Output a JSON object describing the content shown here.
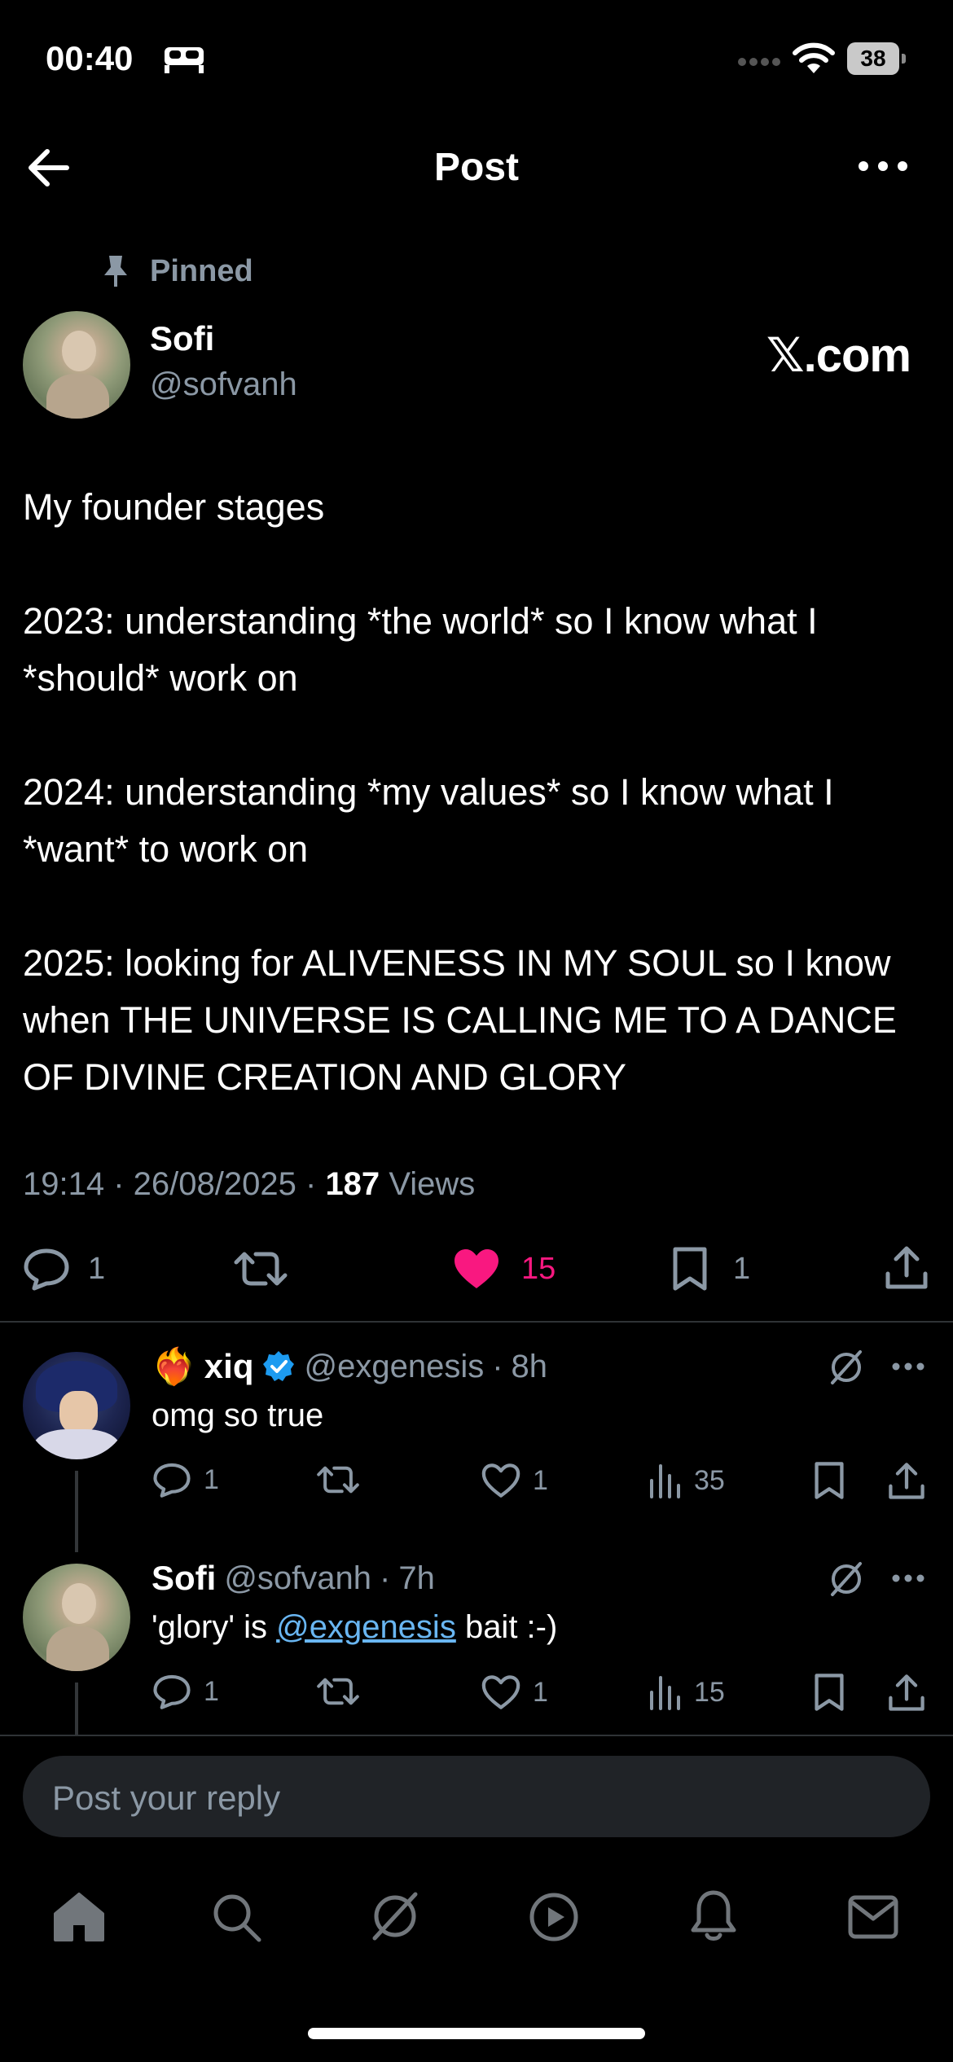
{
  "status_bar": {
    "time": "00:40",
    "battery": "38",
    "icons": [
      "bed-icon",
      "signal-dots",
      "wifi-icon",
      "battery"
    ]
  },
  "header": {
    "title": "Post",
    "back_icon": "arrow-left-icon",
    "more_icon": "more-horizontal-icon"
  },
  "post": {
    "pinned_label": "Pinned",
    "author_name": "Sofi",
    "author_handle": "@sofvanh",
    "brand": "𝕏.com",
    "text": "My founder stages\n\n2023: understanding *the world* so I know what I *should* work on\n\n2024: understanding *my values* so I know what I *want* to work on\n\n2025: looking for ALIVENESS IN MY SOUL so I know when THE UNIVERSE IS CALLING ME TO A DANCE OF DIVINE CREATION AND GLORY",
    "time": "19:14",
    "date": "26/08/2025",
    "views_count": "187",
    "views_label": "Views",
    "actions": {
      "replies": "1",
      "likes": "15",
      "bookmarks": "1"
    },
    "colors": {
      "like": "#f91880",
      "secondary_text": "#8b98a5"
    }
  },
  "replies": [
    {
      "emoji": "❤️‍🔥",
      "name": "xiq",
      "verified": true,
      "handle": "@exgenesis",
      "time": "8h",
      "text": "omg so true",
      "replies": "1",
      "likes": "1",
      "views": "35"
    },
    {
      "name": "Sofi",
      "handle": "@sofvanh",
      "time": "7h",
      "text_before": "'glory' is ",
      "mention": "@exgenesis",
      "text_after": " bait :-)",
      "replies": "1",
      "likes": "1",
      "views": "15"
    }
  ],
  "reply_box": {
    "placeholder": "Post your reply"
  },
  "tab_bar": [
    "home-icon",
    "search-icon",
    "grok-icon",
    "video-icon",
    "notifications-icon",
    "messages-icon"
  ]
}
